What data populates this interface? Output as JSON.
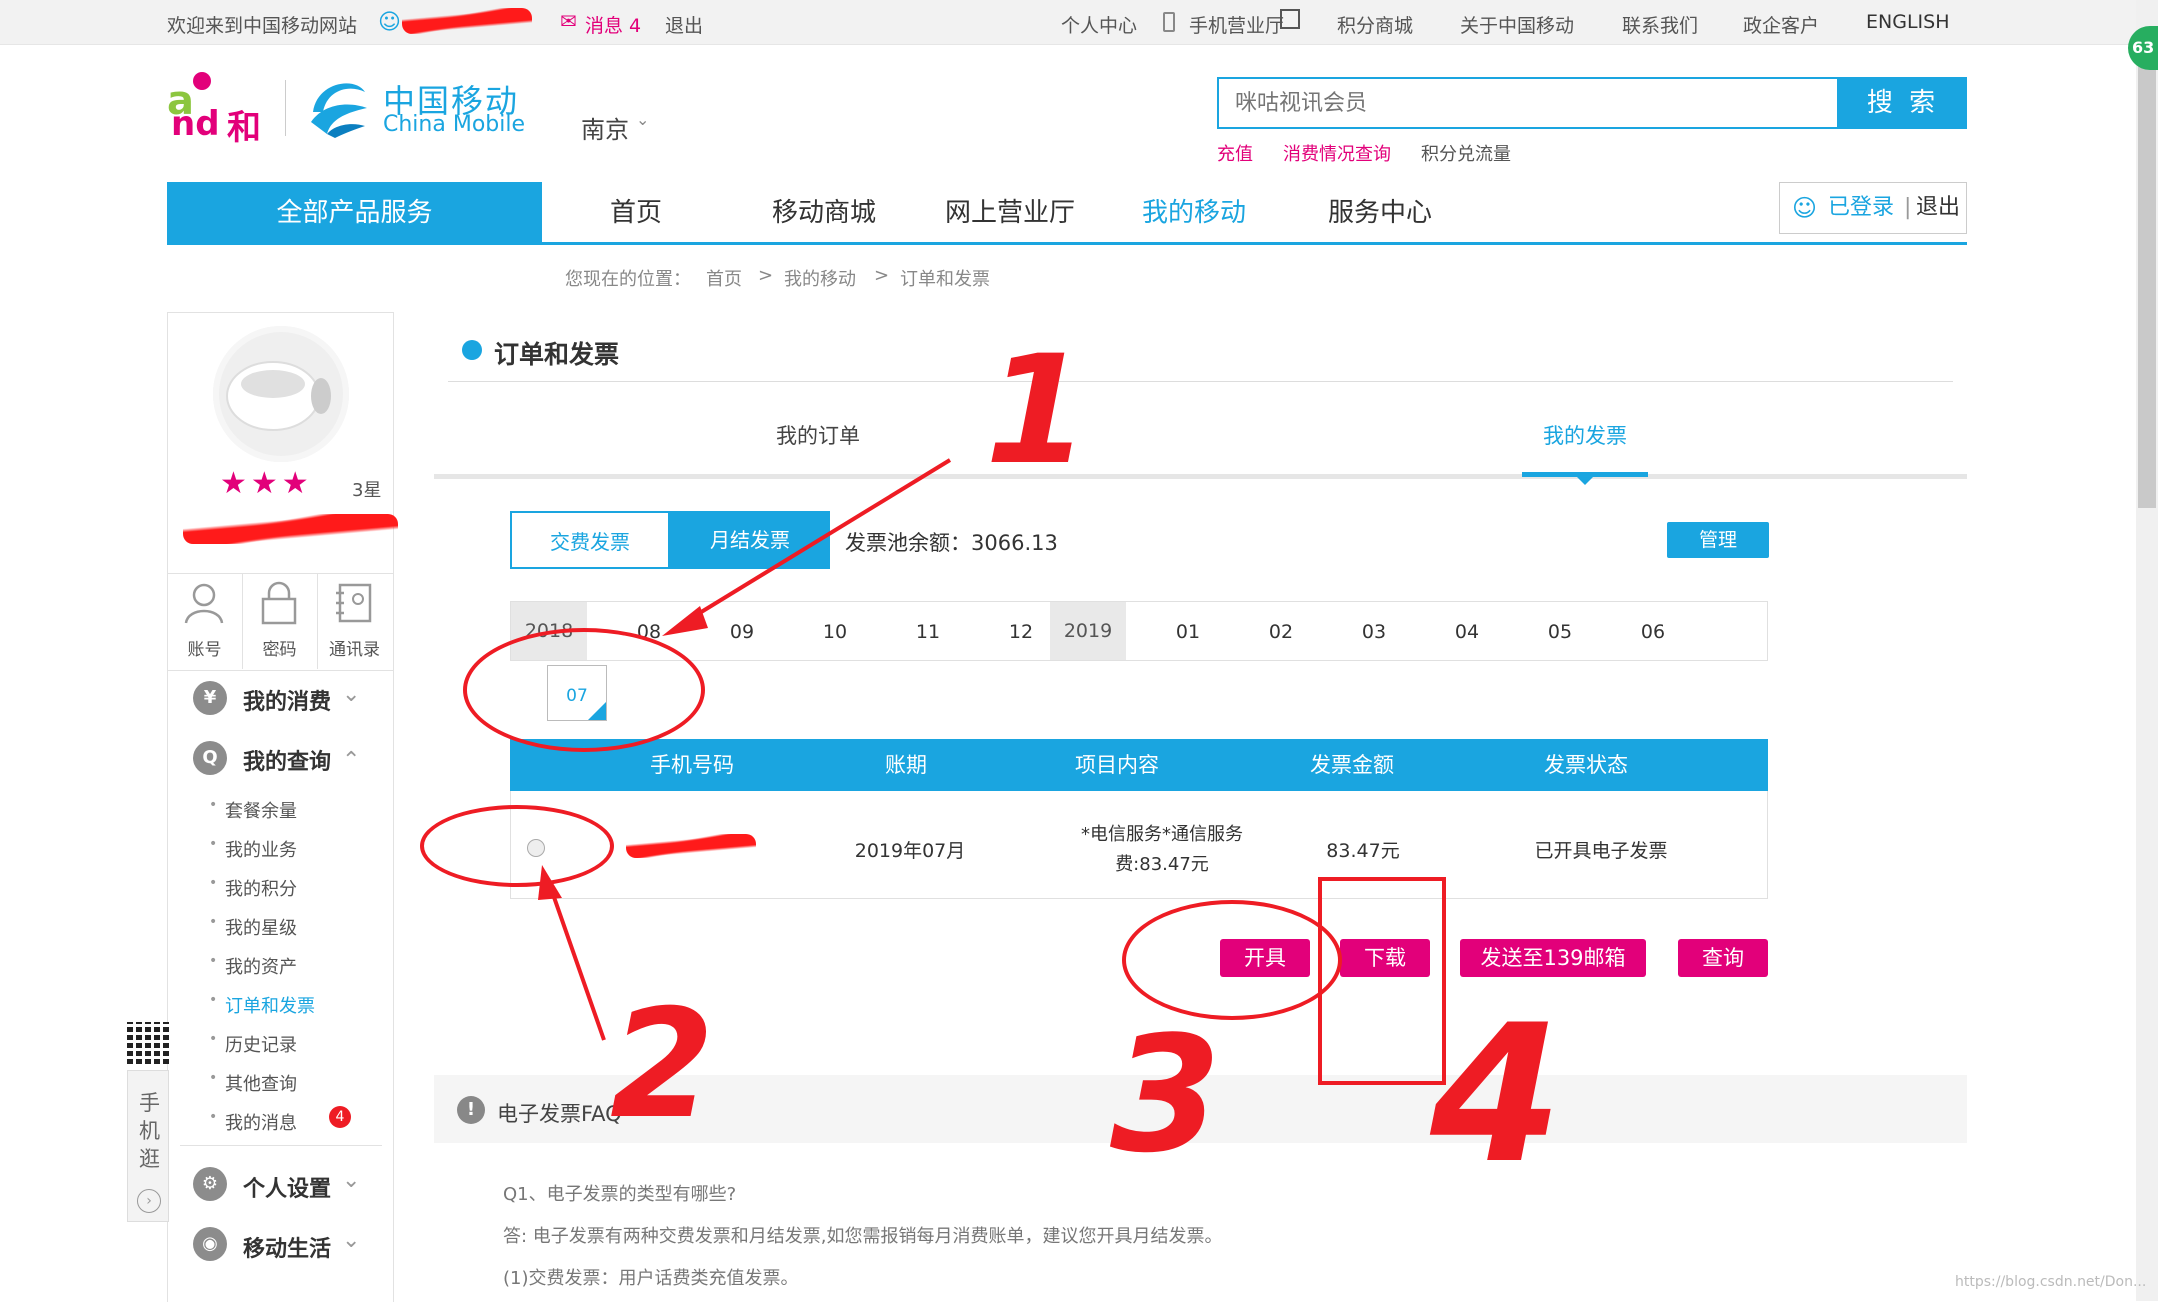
{
  "topbar": {
    "welcome": "欢迎来到中国移动网站",
    "message": "消息 4",
    "logout": "退出",
    "links": [
      "个人中心",
      "手机营业厅",
      "积分商城",
      "关于中国移动",
      "联系我们",
      "政企客户",
      "ENGLISH"
    ]
  },
  "header": {
    "brand_he": "和",
    "brand_cn": "中国移动",
    "brand_en": "China Mobile",
    "city": "南京",
    "search_placeholder": "咪咕视讯会员",
    "search_button": "搜 索",
    "quick_links": [
      "充值",
      "消费情况查询",
      "积分兑流量"
    ]
  },
  "nav": {
    "all_products": "全部产品服务",
    "items": [
      "首页",
      "移动商城",
      "网上营业厅",
      "我的移动",
      "服务中心"
    ],
    "logged_in": "已登录",
    "logout": "退出"
  },
  "breadcrumb": {
    "label": "您现在的位置：",
    "items": [
      "首页",
      "我的移动",
      "订单和发票"
    ],
    "sep": ">"
  },
  "sidebar": {
    "stars_text": "3星",
    "stars_count": 3,
    "buttons": [
      "账号",
      "密码",
      "通讯录"
    ],
    "menu_consume": "我的消费",
    "menu_query": "我的查询",
    "query_items": [
      "套餐余量",
      "我的业务",
      "我的积分",
      "我的星级",
      "我的资产",
      "订单和发票",
      "历史记录",
      "其他查询",
      "我的消息"
    ],
    "message_badge": "4",
    "menu_settings": "个人设置",
    "menu_life": "移动生活",
    "mobile_tab": "手机逛"
  },
  "content": {
    "title": "订单和发票",
    "tabs": [
      "我的订单",
      "我的发票"
    ],
    "segments": [
      "交费发票",
      "月结发票"
    ],
    "pool_balance": "发票池余额：3066.13",
    "manage": "管理",
    "years": [
      "2018",
      "2019"
    ],
    "months_2018": [
      "08",
      "09",
      "10",
      "11",
      "12"
    ],
    "months_2019": [
      "01",
      "02",
      "03",
      "04",
      "05",
      "06"
    ],
    "selected_month": "07",
    "table_headers": [
      "手机号码",
      "账期",
      "项目内容",
      "发票金额",
      "发票状态"
    ],
    "row": {
      "period": "2019年07月",
      "content_line1": "*电信服务*通信服务",
      "content_line2": "费:83.47元",
      "amount": "83.47元",
      "status": "已开具电子发票"
    },
    "actions": [
      "开具",
      "下载",
      "发送至139邮箱",
      "查询"
    ]
  },
  "faq": {
    "title": "电子发票FAQ",
    "q1": "Q1、电子发票的类型有哪些?",
    "a1": "答: 电子发票有两种交费发票和月结发票,如您需报销每月消费账单，建议您开具月结发票。",
    "a1_1": "(1)交费发票：用户话费类充值发票。"
  },
  "annotations": [
    "1",
    "2",
    "3",
    "4"
  ],
  "side_badge": "63",
  "watermark": "https://blog.csdn.net/Don..."
}
